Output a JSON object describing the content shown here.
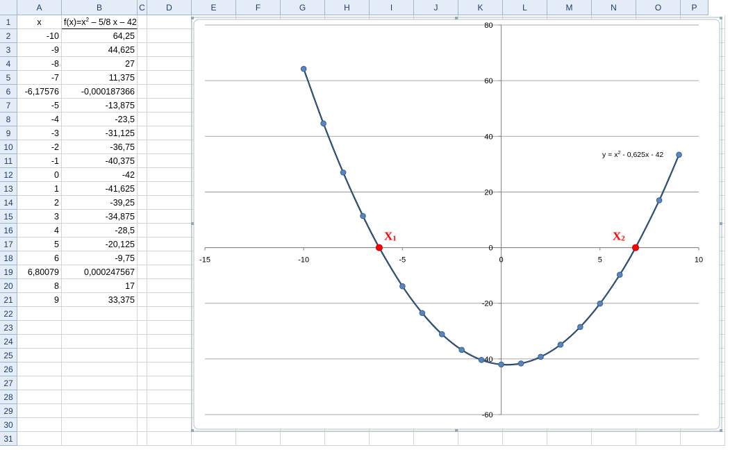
{
  "sheet": {
    "columns": [
      "A",
      "B",
      "C",
      "D",
      "E",
      "F",
      "G",
      "H",
      "I",
      "J",
      "K",
      "L",
      "M",
      "N",
      "O",
      "P"
    ],
    "rows": [
      "1",
      "2",
      "3",
      "4",
      "5",
      "6",
      "7",
      "8",
      "9",
      "10",
      "11",
      "12",
      "13",
      "14",
      "15",
      "16",
      "17",
      "18",
      "19",
      "20",
      "21",
      "22",
      "23",
      "24",
      "25",
      "26",
      "27",
      "28",
      "29",
      "30",
      "31"
    ],
    "header_x": "x",
    "header_f_prefix": "f(x)=x",
    "header_f_exp": "2",
    "header_f_suffix": " – 5/8 x – 42",
    "data_rows": [
      {
        "a": "-10",
        "b": "64,25"
      },
      {
        "a": "-9",
        "b": "44,625"
      },
      {
        "a": "-8",
        "b": "27"
      },
      {
        "a": "-7",
        "b": "11,375"
      },
      {
        "a": "-6,17576",
        "b": "-0,000187366"
      },
      {
        "a": "-5",
        "b": "-13,875"
      },
      {
        "a": "-4",
        "b": "-23,5"
      },
      {
        "a": "-3",
        "b": "-31,125"
      },
      {
        "a": "-2",
        "b": "-36,75"
      },
      {
        "a": "-1",
        "b": "-40,375"
      },
      {
        "a": "0",
        "b": "-42"
      },
      {
        "a": "1",
        "b": "-41,625"
      },
      {
        "a": "2",
        "b": "-39,25"
      },
      {
        "a": "3",
        "b": "-34,875"
      },
      {
        "a": "4",
        "b": "-28,5"
      },
      {
        "a": "5",
        "b": "-20,125"
      },
      {
        "a": "6",
        "b": "-9,75"
      },
      {
        "a": "6,80079",
        "b": "0,000247567"
      },
      {
        "a": "8",
        "b": "17"
      },
      {
        "a": "9",
        "b": "33,375"
      }
    ]
  },
  "chart_data": {
    "type": "scatter",
    "xlim": [
      -15,
      10
    ],
    "ylim": [
      -60,
      80
    ],
    "x_ticks": [
      "-15",
      "-10",
      "-5",
      "0",
      "5",
      "10"
    ],
    "y_ticks": [
      "80",
      "60",
      "40",
      "20",
      "0",
      "-20",
      "-40",
      "-60"
    ],
    "grid": "horizontal",
    "series": [
      {
        "x": [
          -10,
          -9,
          -8,
          -7,
          -5,
          -4,
          -3,
          -2,
          -1,
          0,
          1,
          2,
          3,
          4,
          5,
          6,
          8,
          9
        ],
        "y": [
          64.25,
          44.625,
          27,
          11.375,
          -13.875,
          -23.5,
          -31.125,
          -36.75,
          -40.375,
          -42,
          -41.625,
          -39.25,
          -34.875,
          -28.5,
          -20.125,
          -9.75,
          17,
          33.375
        ],
        "marker_color": "#5a86bf",
        "line_color": "#1e3a5a"
      }
    ],
    "roots": [
      {
        "x": -6.17576,
        "y": 0,
        "label": "X",
        "sub": "1",
        "color": "#ff0000"
      },
      {
        "x": 6.80079,
        "y": 0,
        "label": "X",
        "sub": "2",
        "color": "#ff0000"
      }
    ],
    "trendline_label": "y = x",
    "trendline_exp": "2",
    "trendline_rest": " - 0,625x - 42"
  }
}
